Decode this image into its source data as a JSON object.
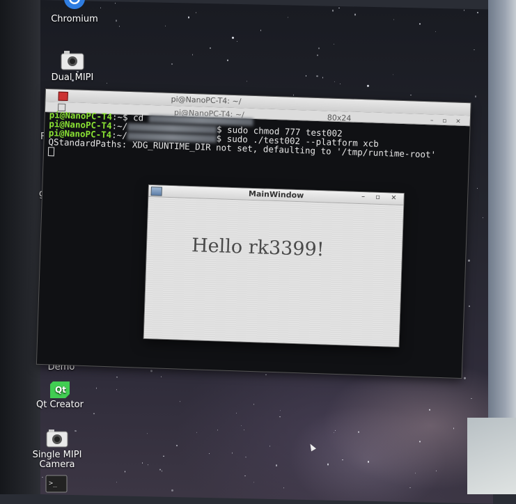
{
  "desktop": {
    "icons": [
      {
        "id": "chromium",
        "label": "Chromium",
        "icon": "chromium-icon"
      },
      {
        "id": "dual-mipi",
        "label": "Dual MIPI",
        "icon": "camera-icon"
      },
      {
        "id": "fr",
        "label": "Fr",
        "icon": "app-icon"
      },
      {
        "id": "gl",
        "label": "gl",
        "icon": "app-icon"
      },
      {
        "id": "opencv",
        "label": "OpenCV\nDemo",
        "icon": "opencv-icon"
      },
      {
        "id": "qtcreator",
        "label": "Qt Creator",
        "icon": "qt-icon"
      },
      {
        "id": "single-mipi",
        "label": "Single MIPI\nCamera",
        "icon": "camera-icon"
      },
      {
        "id": "terminal",
        "label": "",
        "icon": "terminal-icon"
      }
    ]
  },
  "terminal": {
    "title": "pi@NanoPC-T4: ~/",
    "subtitle": "pi@NanoPC-T4: ~/",
    "size": "80x24",
    "lines": {
      "l1_prompt": "pi@NanoPC-T4",
      "l1_rest": ":~$ cd ",
      "l2_prompt": "pi@NanoPC-T4",
      "l2_rest": ":~/",
      "l2_cmd": "$ sudo chmod 777 test002",
      "l3_prompt": "pi@NanoPC-T4",
      "l3_rest": ":~/",
      "l3_cmd": "$ sudo ./test002 --platform xcb",
      "l4": "QStandardPaths: XDG_RUNTIME_DIR not set, defaulting to '/tmp/runtime-root'"
    }
  },
  "mainwindow": {
    "title": "MainWindow",
    "label": "Hello rk3399!"
  },
  "colors": {
    "prompt": "#8ae234",
    "terminal_bg": "#101114",
    "window_bg": "#d9d9d9"
  }
}
